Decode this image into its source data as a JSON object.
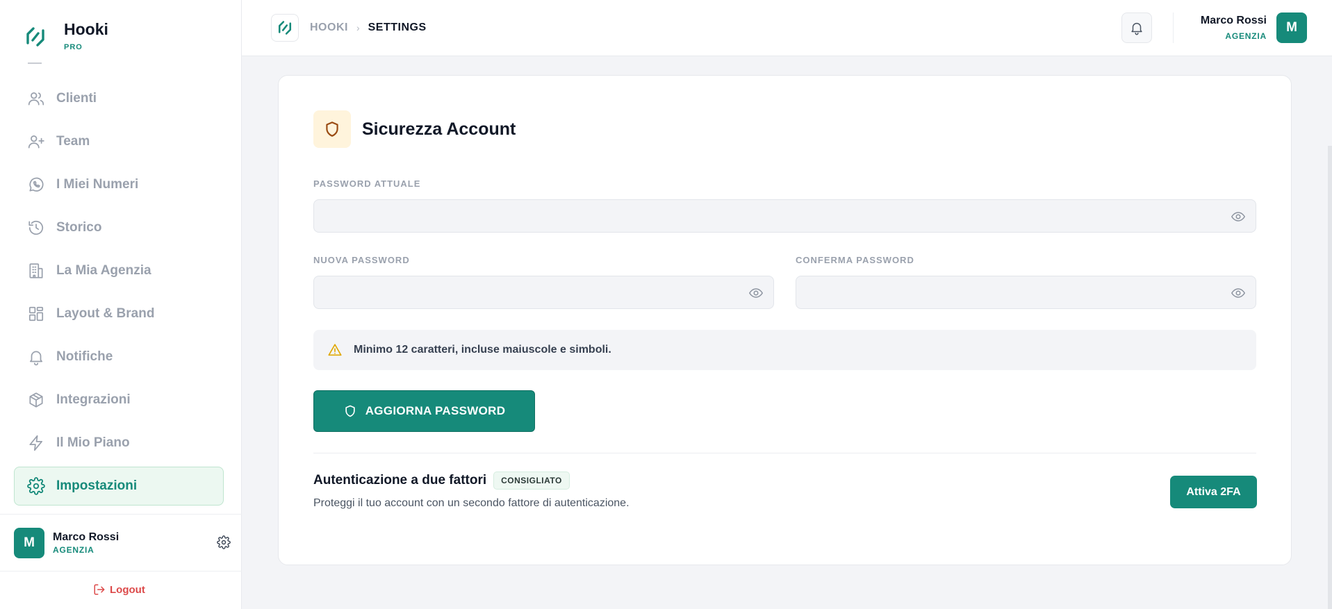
{
  "brand": {
    "name": "Hooki",
    "tier": "PRO"
  },
  "sidebar": {
    "items": [
      {
        "label": "Clienti",
        "icon": "users-icon"
      },
      {
        "label": "Team",
        "icon": "user-plus-icon"
      },
      {
        "label": "I Miei Numeri",
        "icon": "whatsapp-icon"
      },
      {
        "label": "Storico",
        "icon": "history-icon"
      },
      {
        "label": "La Mia Agenzia",
        "icon": "building-icon"
      },
      {
        "label": "Layout & Brand",
        "icon": "layout-icon"
      },
      {
        "label": "Notifiche",
        "icon": "bell-icon"
      },
      {
        "label": "Integrazioni",
        "icon": "package-icon"
      },
      {
        "label": "Il Mio Piano",
        "icon": "lightning-icon"
      },
      {
        "label": "Impostazioni",
        "icon": "gear-icon",
        "active": true
      }
    ],
    "user": {
      "initial": "M",
      "name": "Marco Rossi",
      "role": "AGENZIA"
    },
    "logout_label": "Logout"
  },
  "header": {
    "breadcrumb_root": "HOOKI",
    "breadcrumb_separator": "›",
    "breadcrumb_current": "SETTINGS",
    "user": {
      "initial": "M",
      "name": "Marco Rossi",
      "role": "AGENZIA"
    }
  },
  "security": {
    "title": "Sicurezza Account",
    "current_password_label": "PASSWORD ATTUALE",
    "current_password_value": "",
    "new_password_label": "NUOVA PASSWORD",
    "new_password_value": "",
    "confirm_password_label": "CONFERMA PASSWORD",
    "confirm_password_value": "",
    "hint": "Minimo 12 caratteri, incluse maiuscole e simboli.",
    "update_button": "AGGIORNA PASSWORD"
  },
  "two_factor": {
    "title": "Autenticazione a due fattori",
    "badge": "CONSIGLIATO",
    "description": "Proteggi il tuo account con un secondo fattore di autenticazione.",
    "button": "Attiva 2FA"
  },
  "colors": {
    "accent": "#168a7a",
    "active_bg": "#ecf8f1",
    "warning": "#e0a800",
    "danger": "#dc4a4a",
    "shield_bg": "#fff4dc"
  }
}
